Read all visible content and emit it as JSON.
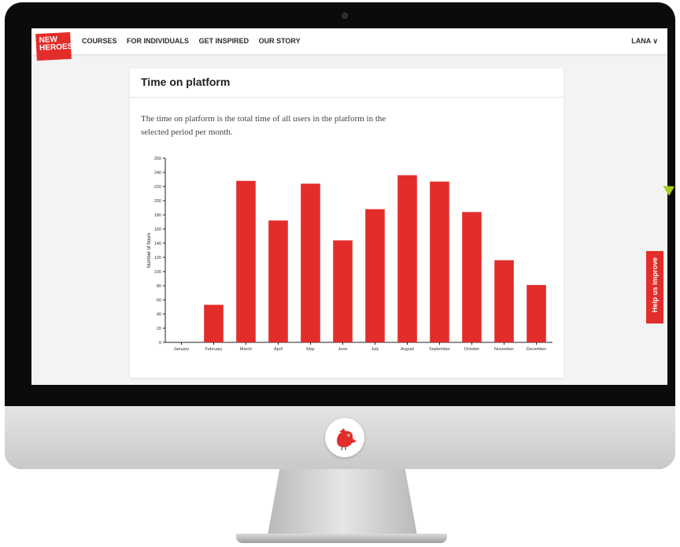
{
  "brand": {
    "logo_text": "NEW\nHEROES"
  },
  "nav": {
    "items": [
      {
        "label": "COURSES"
      },
      {
        "label": "FOR INDIVIDUALS"
      },
      {
        "label": "GET INSPIRED"
      },
      {
        "label": "OUR STORY"
      }
    ],
    "user": "LANA",
    "user_chevron": "∨"
  },
  "card": {
    "title": "Time on platform",
    "description": "The time on platform is the total time of all users in the platform in the selected period per month."
  },
  "feedback": {
    "label": "Help us improve"
  },
  "colors": {
    "accent": "#e32d2a",
    "cursor": "#a6cf1e"
  },
  "icons": {
    "cursor": "arrow-cursor-icon",
    "chevron": "chevron-down-icon",
    "logo": "bird-logo-icon"
  },
  "chart_data": {
    "type": "bar",
    "categories": [
      "January",
      "February",
      "March",
      "April",
      "May",
      "June",
      "July",
      "August",
      "September",
      "October",
      "November",
      "December"
    ],
    "values": [
      0,
      53,
      228,
      172,
      224,
      144,
      188,
      236,
      227,
      184,
      116,
      81
    ],
    "ylabel": "Number of hours",
    "xlabel": "",
    "ylim": [
      0,
      260
    ],
    "yticks": [
      0,
      20,
      40,
      60,
      80,
      100,
      120,
      140,
      160,
      180,
      200,
      220,
      240,
      260
    ],
    "ytick_labels": [
      "0",
      "20",
      "40",
      "60",
      "80",
      "100",
      "120",
      "140",
      "160",
      "180",
      "200",
      "220",
      "240",
      "260"
    ],
    "bar_color": "#e32d2a",
    "grid": false,
    "legend": "none"
  }
}
